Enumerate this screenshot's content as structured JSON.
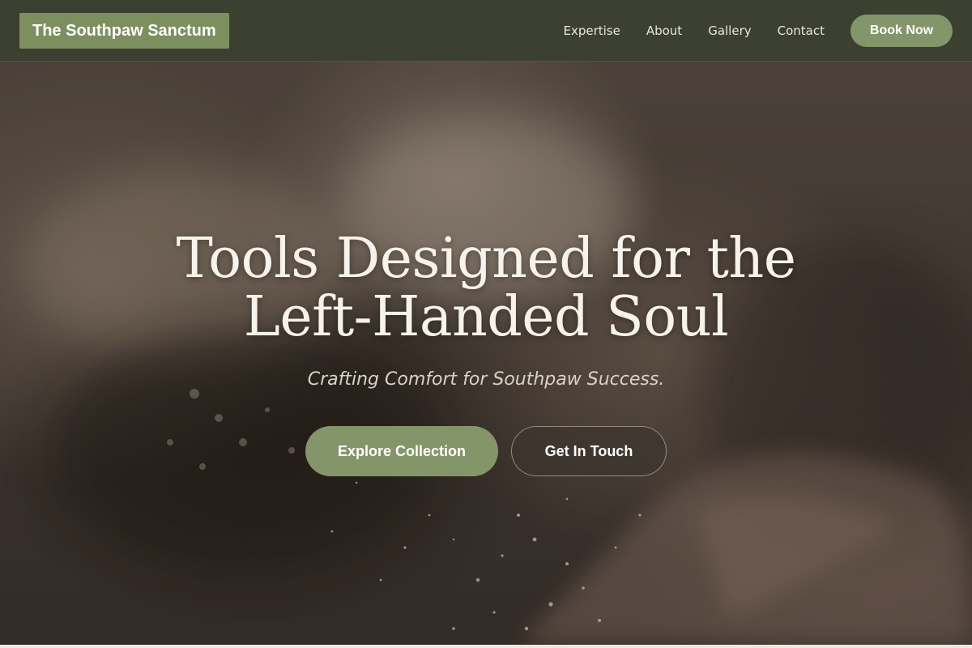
{
  "header": {
    "brand": "The Southpaw Sanctum",
    "nav": [
      "Expertise",
      "About",
      "Gallery",
      "Contact"
    ],
    "cta": "Book Now"
  },
  "hero": {
    "title_line1": "Tools Designed for the",
    "title_line2": "Left-Handed Soul",
    "subtitle": "Crafting Comfort for Southpaw Success.",
    "primary_button": "Explore Collection",
    "secondary_button": "Get In Touch"
  },
  "colors": {
    "nav_bg": "#3b4030",
    "accent": "#83966b",
    "text_light": "#f7f3ea"
  }
}
